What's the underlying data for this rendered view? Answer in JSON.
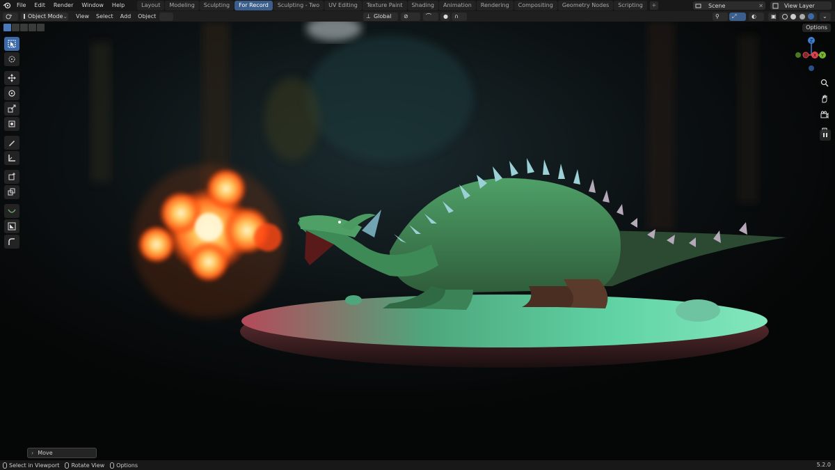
{
  "menu": {
    "items": [
      "File",
      "Edit",
      "Render",
      "Window",
      "Help"
    ]
  },
  "workspace_tabs": [
    {
      "label": "Layout"
    },
    {
      "label": "Modeling"
    },
    {
      "label": "Sculpting"
    },
    {
      "label": "For Record",
      "active": true
    },
    {
      "label": "Sculpting - Two"
    },
    {
      "label": "UV Editing"
    },
    {
      "label": "Texture Paint"
    },
    {
      "label": "Shading"
    },
    {
      "label": "Animation"
    },
    {
      "label": "Rendering"
    },
    {
      "label": "Compositing"
    },
    {
      "label": "Geometry Nodes"
    },
    {
      "label": "Scripting"
    }
  ],
  "scene": {
    "name": "Scene"
  },
  "view_layer": {
    "name": "View Layer"
  },
  "header": {
    "mode": "Object Mode",
    "menus": [
      "View",
      "Select",
      "Add",
      "Object"
    ],
    "transform_orientation": "Global"
  },
  "viewport": {
    "options_label": "Options",
    "gizmo_axes": [
      "X",
      "Y",
      "Z"
    ]
  },
  "operator_panel": {
    "label": "Move"
  },
  "statusbar": {
    "items": [
      "Select in Viewport",
      "Rotate View",
      "Options"
    ],
    "version": "5.2.0"
  },
  "colors": {
    "accent": "#3b5e8c",
    "active_tool": "#3c6aa8",
    "axis_x": "#e4424f",
    "axis_y": "#79b531",
    "axis_z": "#3e7fd2"
  },
  "icons": [
    "blender-logo-icon",
    "editor-type-icon",
    "select-box-icon",
    "cursor-icon",
    "move-icon",
    "rotate-icon",
    "scale-icon",
    "transform-icon",
    "annotate-icon",
    "measure-icon",
    "add-cube-icon",
    "zoom-icon",
    "hand-icon",
    "camera-icon",
    "grid-icon"
  ]
}
